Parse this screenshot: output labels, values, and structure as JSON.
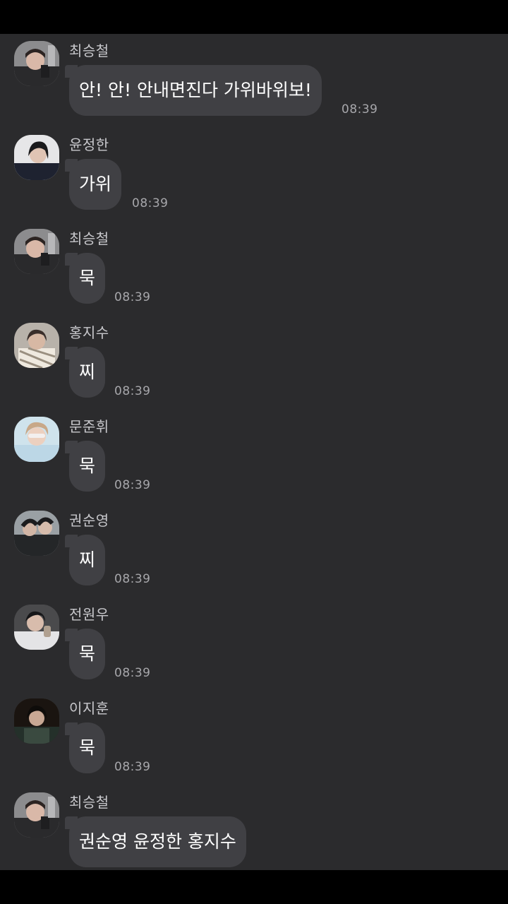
{
  "messages": [
    {
      "sender": "최승철",
      "text": "안! 안! 안내면진다 가위바위보!",
      "time": "08:39",
      "avatar": "avatar-seungcheol"
    },
    {
      "sender": "윤정한",
      "text": "가위",
      "time": "08:39",
      "avatar": "avatar-jeonghan"
    },
    {
      "sender": "최승철",
      "text": "묵",
      "time": "08:39",
      "avatar": "avatar-seungcheol"
    },
    {
      "sender": "홍지수",
      "text": "찌",
      "time": "08:39",
      "avatar": "avatar-jisoo"
    },
    {
      "sender": "문준휘",
      "text": "묵",
      "time": "08:39",
      "avatar": "avatar-junhui"
    },
    {
      "sender": "권순영",
      "text": "찌",
      "time": "08:39",
      "avatar": "avatar-soonyoung"
    },
    {
      "sender": "전원우",
      "text": "묵",
      "time": "08:39",
      "avatar": "avatar-wonwoo"
    },
    {
      "sender": "이지훈",
      "text": "묵",
      "time": "08:39",
      "avatar": "avatar-jihoon"
    },
    {
      "sender": "최승철",
      "text": "권순영 윤정한 홍지수",
      "time": "",
      "avatar": "avatar-seungcheol"
    }
  ],
  "colors": {
    "background": "#2b2b2d",
    "bubble": "#404044",
    "sender_text": "#c8c8cc",
    "time_text": "#a7a7ab"
  }
}
